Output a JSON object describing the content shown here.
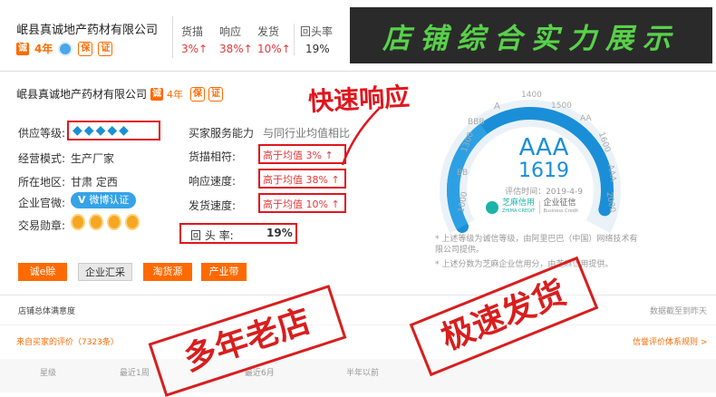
{
  "header": {
    "company": "岷县真诚地产药材有限公司",
    "cheng_badge": "诚",
    "years": "4年",
    "stats": [
      {
        "label": "货描",
        "value": "3%↑"
      },
      {
        "label": "响应",
        "value": "38%↑"
      },
      {
        "label": "发货",
        "value": "10%↑"
      },
      {
        "label": "回头率",
        "value": "19%"
      }
    ],
    "banner": "店铺综合实力展示"
  },
  "card": {
    "company": "岷县真诚地产药材有限公司",
    "cheng_badge": "诚",
    "years": "4年",
    "supplier_level_label": "供应等级:",
    "biz_mode_label": "经营模式:",
    "biz_mode_value": "生产厂家",
    "region_label": "所在地区:",
    "region_value": "甘肃 定西",
    "weibo_label": "企业官微:",
    "weibo_button": "微博认证",
    "medal_label": "交易勋章:",
    "service_title": "买家服务能力",
    "service_compare": "与同行业均值相比",
    "rows": [
      {
        "label": "货描相符:",
        "value": "高于均值 3% ↑"
      },
      {
        "label": "响应速度:",
        "value": "高于均值 38% ↑"
      },
      {
        "label": "发货速度:",
        "value": "高于均值 10% ↑"
      }
    ],
    "return_label": "回 头 率:",
    "return_value": "19%",
    "handwritten": "快速响应"
  },
  "tags": [
    "诚e赊",
    "企业汇采",
    "淘货源",
    "产业带"
  ],
  "gauge": {
    "rating": "AAA",
    "score": "1619",
    "date": "评估时间：2019-4-9",
    "ticks": [
      "1000",
      "BB",
      "1300",
      "BBB",
      "A",
      "1400",
      "1500",
      "AA",
      "1600",
      "AAA",
      "2000"
    ],
    "zhima_logo": "芝麻信用",
    "zhima_sub": "ZHIMA CREDIT",
    "corp_credit": "企业征信",
    "corp_credit_sub": "Business Credit"
  },
  "notes": {
    "line1": "* 上述等级为诚信等级，由阿里巴巴（中国）网络技术有限公司提供。",
    "line2": "* 上述分数为芝麻企业信用分，由芝麻信用提供。"
  },
  "panel": {
    "title": "店铺总体满意度",
    "right_note": "数据截至到昨天",
    "reviews": "来自买家的评价（7323条）",
    "rules_link": "信誉评价体系规则 >",
    "cols": [
      "星级",
      "最近1周",
      "最近6月",
      "半年以前"
    ]
  },
  "stamps": [
    "多年老店",
    "极速发货"
  ],
  "colors": {
    "accent": "#ff6a00",
    "red": "#e4393c",
    "gauge": "#1a8fd8",
    "banner_bg": "#2a2a2a",
    "banner_text": "#58d14a"
  }
}
